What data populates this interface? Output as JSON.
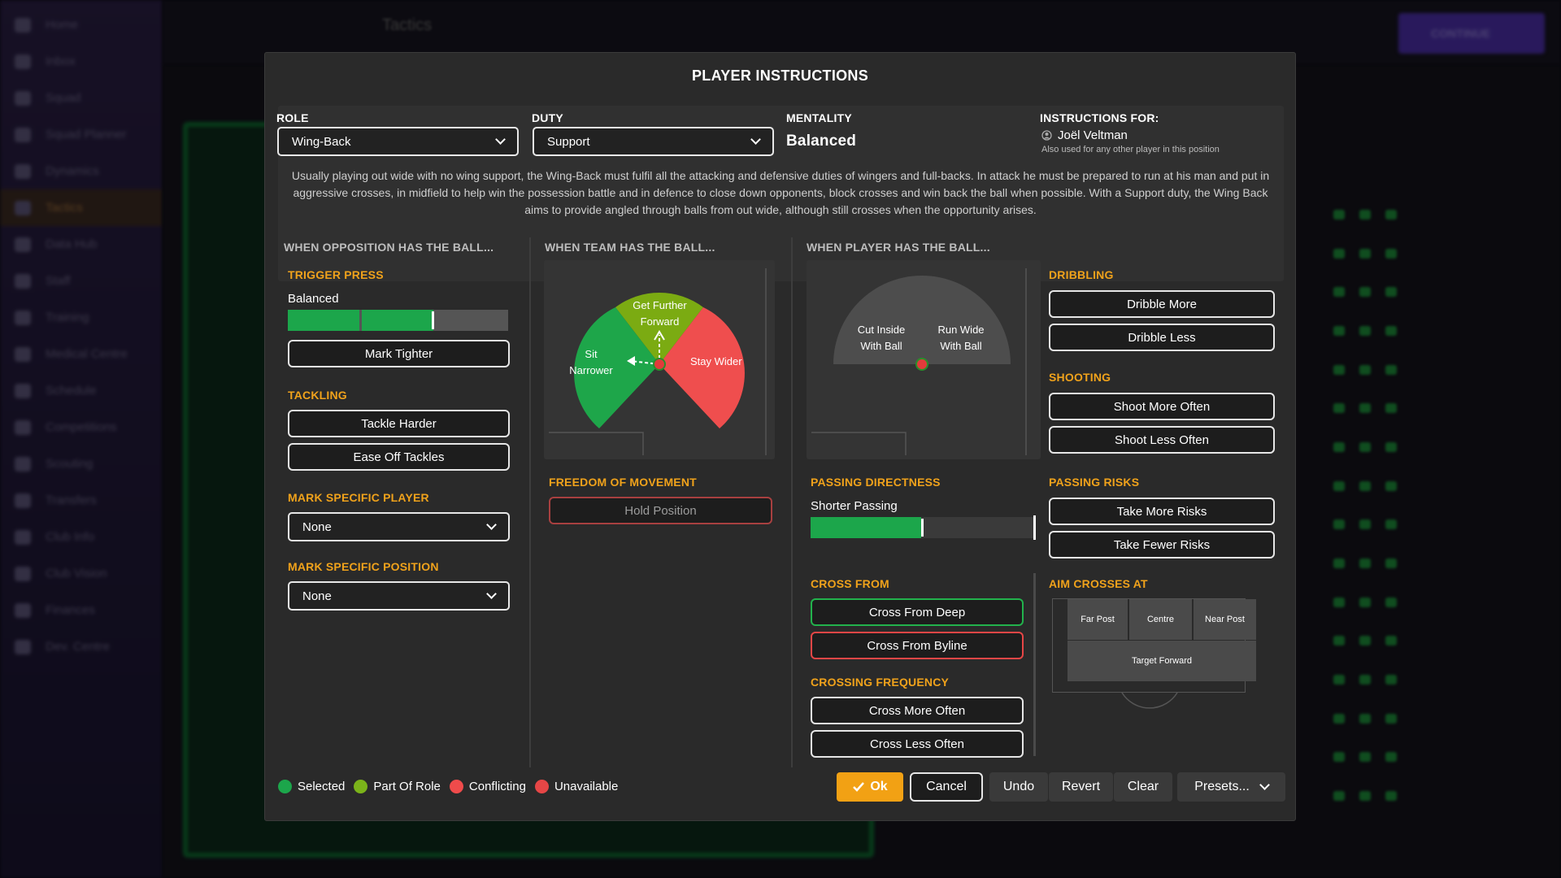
{
  "background": {
    "sidebar": [
      "Home",
      "Inbox",
      "Squad",
      "Squad Planner",
      "Dynamics",
      "Tactics",
      "Data Hub",
      "Staff",
      "Training",
      "Medical Centre",
      "Schedule",
      "Competitions",
      "Scouting",
      "Transfers",
      "Club Info",
      "Club Vision",
      "Finances",
      "Dev. Centre"
    ],
    "page_title": "Tactics",
    "continue_label": "CONTINUE"
  },
  "modal": {
    "title": "PLAYER INSTRUCTIONS",
    "role": {
      "label": "ROLE",
      "value": "Wing-Back"
    },
    "duty": {
      "label": "DUTY",
      "value": "Support"
    },
    "mentality": {
      "label": "MENTALITY",
      "value": "Balanced"
    },
    "instructions_for": {
      "label": "INSTRUCTIONS FOR:",
      "player": "Joël Veltman",
      "note": "Also used for any other player in this position"
    },
    "description": "Usually playing out wide with no wing support, the Wing-Back must fulfil all the attacking and defensive duties of wingers and full-backs. In attack he must be prepared to run at his man and put in aggressive crosses, in midfield to help win the possession battle and in defence to close down opponents, block crosses and win back the ball when possible. With a Support duty, the Wing Back aims to provide angled through balls from out wide, although still crosses when the opportunity arises."
  },
  "opposition": {
    "heading": "WHEN OPPOSITION HAS THE BALL...",
    "trigger_press": {
      "label": "TRIGGER PRESS",
      "value": "Balanced",
      "level": 0.66
    },
    "mark_tighter": "Mark Tighter",
    "tackling": {
      "label": "TACKLING",
      "harder": "Tackle Harder",
      "ease": "Ease Off Tackles"
    },
    "mark_player": {
      "label": "MARK SPECIFIC PLAYER",
      "value": "None"
    },
    "mark_position": {
      "label": "MARK SPECIFIC POSITION",
      "value": "None"
    }
  },
  "team": {
    "heading": "WHEN TEAM HAS THE BALL...",
    "dial": {
      "forward": "Get Further Forward",
      "narrow_1": "Sit",
      "narrow_2": "Narrower",
      "wider": "Stay Wider"
    },
    "freedom": {
      "label": "FREEDOM OF MOVEMENT",
      "hold": "Hold Position"
    }
  },
  "player": {
    "heading": "WHEN PLAYER HAS THE BALL...",
    "dial": {
      "cut_1": "Cut Inside",
      "cut_2": "With Ball",
      "wide_1": "Run Wide",
      "wide_2": "With Ball"
    },
    "passing_directness": {
      "label": "PASSING DIRECTNESS",
      "value": "Shorter Passing",
      "level": 0.5
    },
    "cross_from": {
      "label": "CROSS FROM",
      "deep": "Cross From Deep",
      "byline": "Cross From Byline"
    },
    "crossing_frequency": {
      "label": "CROSSING FREQUENCY",
      "more": "Cross More Often",
      "less": "Cross Less Often"
    },
    "dribbling": {
      "label": "DRIBBLING",
      "more": "Dribble More",
      "less": "Dribble Less"
    },
    "shooting": {
      "label": "SHOOTING",
      "more": "Shoot More Often",
      "less": "Shoot Less Often"
    },
    "passing_risks": {
      "label": "PASSING RISKS",
      "more": "Take More Risks",
      "fewer": "Take Fewer Risks"
    },
    "aim_crosses": {
      "label": "AIM CROSSES AT",
      "far": "Far Post",
      "centre": "Centre",
      "near": "Near Post",
      "target": "Target Forward"
    }
  },
  "legend": {
    "selected": "Selected",
    "part_of_role": "Part Of Role",
    "conflicting": "Conflicting",
    "unavailable": "Unavailable"
  },
  "footer": {
    "ok": "Ok",
    "cancel": "Cancel",
    "undo": "Undo",
    "revert": "Revert",
    "clear": "Clear",
    "presets": "Presets..."
  },
  "colors": {
    "selected": "#1ca64b",
    "part_of_role": "#7bb31a",
    "conflicting": "#ef4b4b",
    "unavailable": "#e64646",
    "accent": "#f0a21b"
  }
}
